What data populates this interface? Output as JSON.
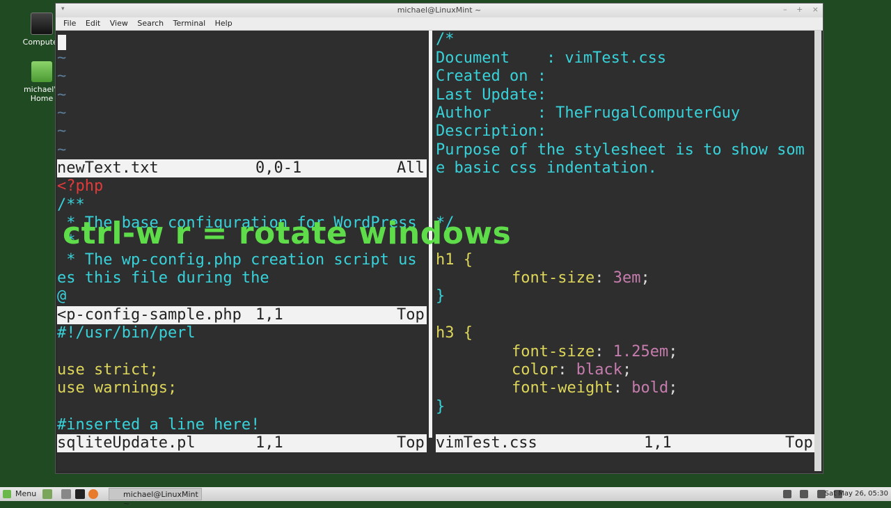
{
  "desktop": {
    "icon_computer_label": "Computer",
    "icon_home_label": "michael's Home"
  },
  "window": {
    "title": "michael@LinuxMint ~",
    "menu": [
      "File",
      "Edit",
      "View",
      "Search",
      "Terminal",
      "Help"
    ]
  },
  "vim": {
    "left_top": {
      "tildes": [
        "~",
        "~",
        "~",
        "~",
        "~",
        "~"
      ],
      "status": {
        "file": "newText.txt",
        "pos": "0,0-1",
        "scroll": "All"
      }
    },
    "left_middle": {
      "lines": [
        "<?php",
        "/**",
        " * The base configuration for WordPress",
        " *",
        " * The wp-config.php creation script us",
        "es this file during the",
        "@"
      ],
      "status": {
        "file": "<p-config-sample.php",
        "pos": "1,1",
        "scroll": "Top"
      }
    },
    "left_bottom": {
      "lines": [
        "#!/usr/bin/perl",
        "",
        "use strict;",
        "use warnings;",
        "",
        "#inserted a line here!"
      ],
      "status": {
        "file": "sqliteUpdate.pl",
        "pos": "1,1",
        "scroll": "Top"
      }
    },
    "right": {
      "comment_lines": [
        "/*",
        "Document    : vimTest.css",
        "Created on :",
        "Last Update:",
        "Author     : TheFrugalComputerGuy",
        "Description:",
        "Purpose of the stylesheet is to show som",
        "e basic css indentation.",
        "*/"
      ],
      "h1_selector": "h1 {",
      "h1_prop": "font-size",
      "h1_value": "3em",
      "close": "}",
      "h3_selector": "h3 {",
      "h3_props": [
        {
          "prop": "font-size",
          "value": "1.25em"
        },
        {
          "prop": "color",
          "value": "black"
        },
        {
          "prop": "font-weight",
          "value": "bold"
        }
      ],
      "status": {
        "file": "vimTest.css",
        "pos": "1,1",
        "scroll": "Top"
      }
    }
  },
  "overlay_caption": "ctrl-w r = rotate windows",
  "taskbar": {
    "menu_label": "Menu",
    "task_label": "michael@LinuxMint ~",
    "clock": "Sat May 26, 05:30"
  }
}
